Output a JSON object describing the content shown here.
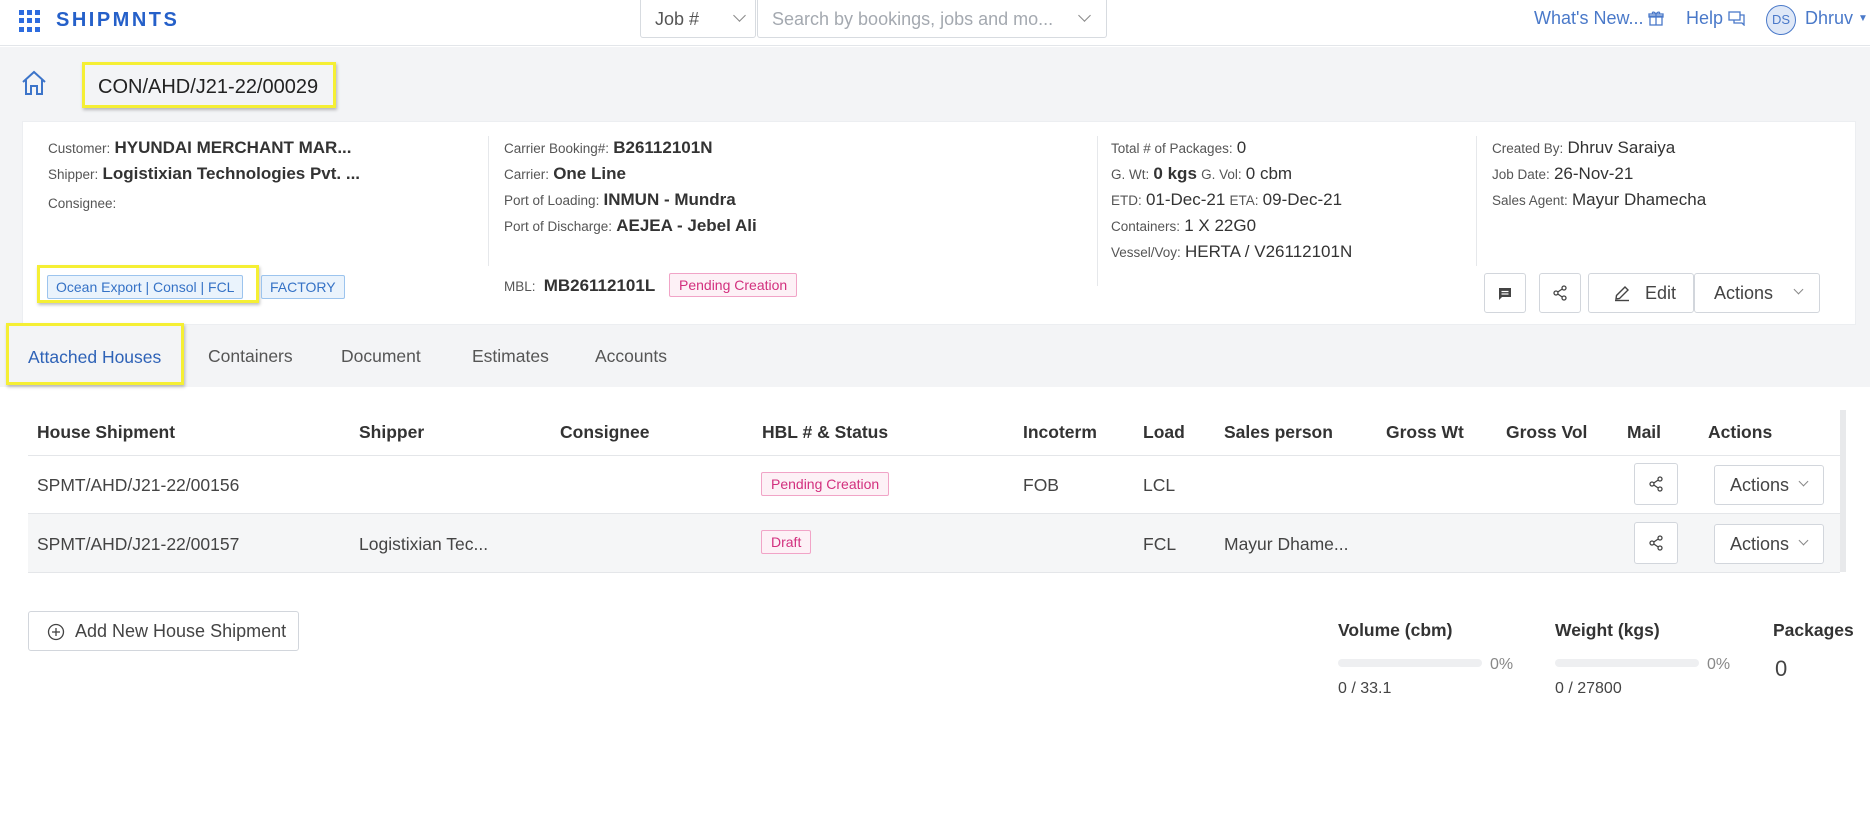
{
  "app": {
    "brand": "SHIPMNTS"
  },
  "header": {
    "job_select_label": "Job #",
    "search_placeholder": "Search by bookings, jobs and mo...",
    "whats_new": "What's New...",
    "help": "Help",
    "avatar_initials": "DS",
    "user_name": "Dhruv"
  },
  "job": {
    "number": "CON/AHD/J21-22/00029",
    "customer_label": "Customer:",
    "customer": "HYUNDAI MERCHANT MAR...",
    "shipper_label": "Shipper:",
    "shipper": "Logistixian Technologies Pvt. ...",
    "consignee_label": "Consignee:",
    "consignee": "",
    "tags": [
      "Ocean Export | Consol | FCL",
      "FACTORY"
    ],
    "carrier_booking_label": "Carrier Booking#:",
    "carrier_booking": "B26112101N",
    "carrier_label": "Carrier:",
    "carrier": "One Line",
    "pol_label": "Port of Loading:",
    "pol": "INMUN - Mundra",
    "pod_label": "Port of Discharge:",
    "pod": "AEJEA - Jebel Ali",
    "mbl_label": "MBL:",
    "mbl": "MB26112101L",
    "mbl_status": "Pending Creation",
    "packages_label": "Total # of Packages:",
    "packages": "0",
    "gwt_label": "G. Wt:",
    "gwt": "0 kgs",
    "gvol_label": "G. Vol:",
    "gvol": "0 cbm",
    "etd_label": "ETD:",
    "etd": "01-Dec-21",
    "eta_label": "ETA:",
    "eta": "09-Dec-21",
    "containers_label": "Containers:",
    "containers": "1 X 22G0",
    "vessel_label": "Vessel/Voy:",
    "vessel": "HERTA / V26112101N",
    "created_by_label": "Created By:",
    "created_by": "Dhruv Saraiya",
    "job_date_label": "Job Date:",
    "job_date": "26-Nov-21",
    "sales_agent_label": "Sales Agent:",
    "sales_agent": "Mayur Dhamecha",
    "edit_label": "Edit",
    "actions_label": "Actions"
  },
  "tabs": [
    "Attached Houses",
    "Containers",
    "Document",
    "Estimates",
    "Accounts"
  ],
  "table": {
    "headers": [
      "House Shipment",
      "Shipper",
      "Consignee",
      "HBL # & Status",
      "Incoterm",
      "Load",
      "Sales person",
      "Gross Wt",
      "Gross Vol",
      "Mail",
      "Actions"
    ],
    "rows": [
      {
        "house": "SPMT/AHD/J21-22/00156",
        "shipper": "",
        "consignee": "",
        "hbl_status": "Pending Creation",
        "incoterm": "FOB",
        "load": "LCL",
        "sales_person": "",
        "gross_wt": "",
        "gross_vol": "",
        "actions": "Actions"
      },
      {
        "house": "SPMT/AHD/J21-22/00157",
        "shipper": "Logistixian Tec...",
        "consignee": "",
        "hbl_status": "Draft",
        "incoterm": "",
        "load": "FCL",
        "sales_person": "Mayur Dhame...",
        "gross_wt": "",
        "gross_vol": "",
        "actions": "Actions"
      }
    ]
  },
  "footer": {
    "add_house_label": "Add New House Shipment",
    "volume_label": "Volume (cbm)",
    "volume_pct": "0%",
    "volume_fraction": 0,
    "volume_value": "0 / 33.1",
    "weight_label": "Weight (kgs)",
    "weight_pct": "0%",
    "weight_fraction": 0,
    "weight_value": "0 / 27800",
    "packages_label": "Packages",
    "packages_value": "0"
  },
  "colors": {
    "brand": "#2560c9",
    "link": "#4a79c9",
    "highlight": "#f5ef34",
    "pending": "#d2307e"
  }
}
